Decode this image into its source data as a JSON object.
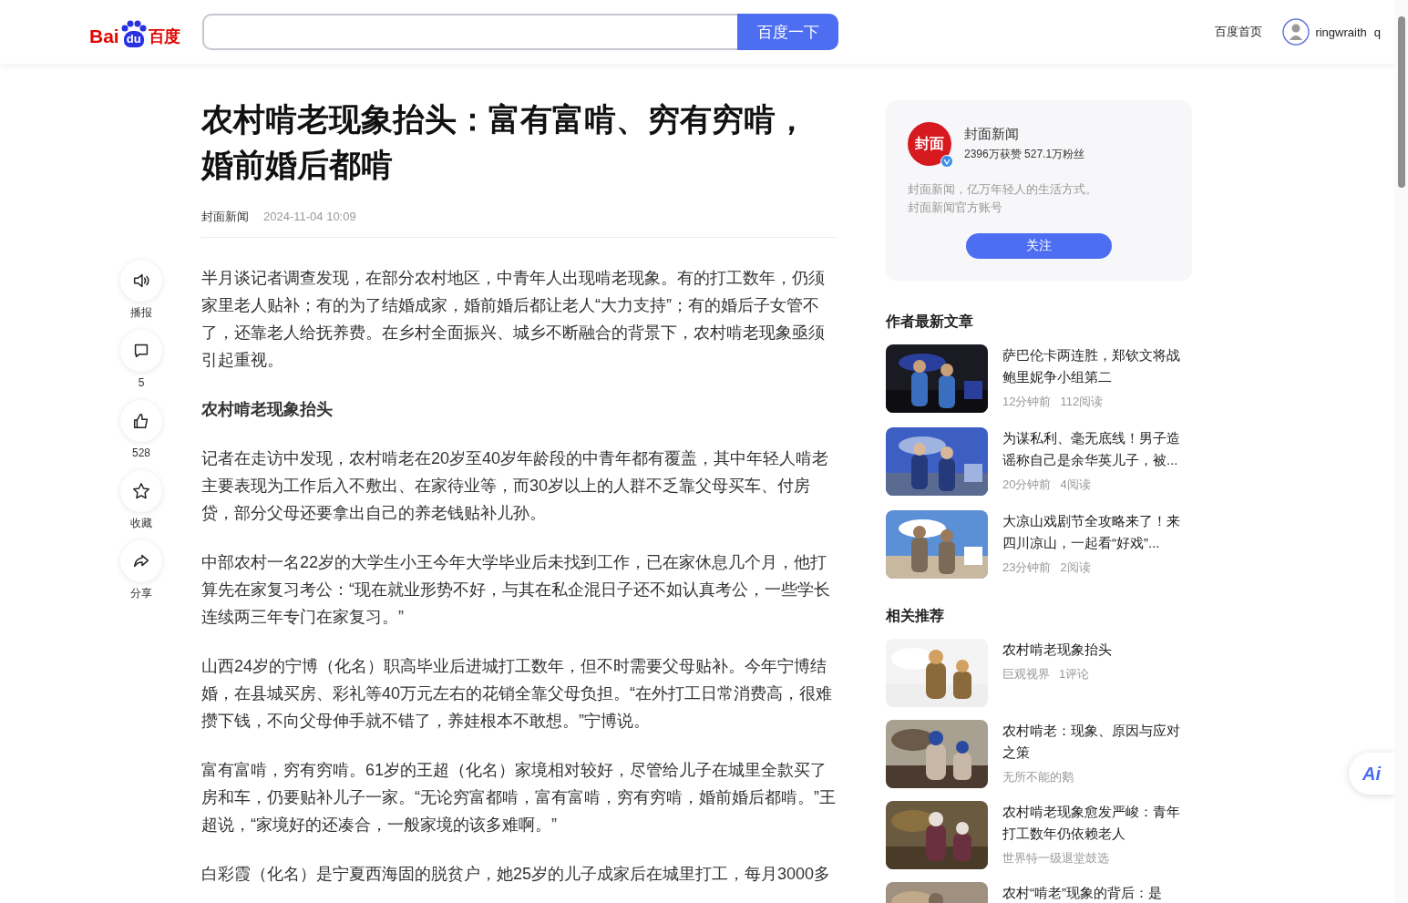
{
  "header": {
    "logo": {
      "left": "Bai",
      "paw": "du",
      "right": "百度"
    },
    "search": {
      "button": "百度一下"
    },
    "nav": {
      "home": "百度首页",
      "user": "ringwraith",
      "user_extra": "q"
    }
  },
  "actions": [
    {
      "kind": "speaker",
      "label": "播报"
    },
    {
      "kind": "comment",
      "label": "5"
    },
    {
      "kind": "like",
      "label": "528"
    },
    {
      "kind": "star",
      "label": "收藏"
    },
    {
      "kind": "share",
      "label": "分享"
    }
  ],
  "article": {
    "title": "农村啃老现象抬头：富有富啃、穷有穷啃，婚前婚后都啃",
    "source": "封面新闻",
    "date": "2024-11-04 10:09",
    "paragraphs": [
      {
        "kind": "text",
        "text": "半月谈记者调查发现，在部分农村地区，中青年人出现啃老现象。有的打工数年，仍须家里老人贴补；有的为了结婚成家，婚前婚后都让老人“大力支持”；有的婚后子女管不了，还靠老人给抚养费。在乡村全面振兴、城乡不断融合的背景下，农村啃老现象亟须引起重视。"
      },
      {
        "kind": "heading",
        "text": "农村啃老现象抬头"
      },
      {
        "kind": "text",
        "text": "记者在走访中发现，农村啃老在20岁至40岁年龄段的中青年都有覆盖，其中年轻人啃老主要表现为工作后入不敷出、在家待业等，而30岁以上的人群不乏靠父母买车、付房贷，部分父母还要拿出自己的养老钱贴补儿孙。"
      },
      {
        "kind": "text",
        "text": "中部农村一名22岁的大学生小王今年大学毕业后未找到工作，已在家休息几个月，他打算先在家复习考公：“现在就业形势不好，与其在私企混日子还不如认真考公，一些学长连续两三年专门在家复习。”"
      },
      {
        "kind": "text",
        "text": "山西24岁的宁博（化名）职高毕业后进城打工数年，但不时需要父母贴补。今年宁博结婚，在县城买房、彩礼等40万元左右的花销全靠父母负担。“在外打工日常消费高，很难攒下钱，不向父母伸手就不错了，养娃根本不敢想。”宁博说。"
      },
      {
        "kind": "text",
        "text": "富有富啃，穷有穷啃。61岁的王超（化名）家境相对较好，尽管给儿子在城里全款买了房和车，仍要贴补儿子一家。“无论穷富都啃，富有富啃，穷有穷啃，婚前婚后都啃。”王超说，“家境好的还凑合，一般家境的该多难啊。”"
      },
      {
        "kind": "text",
        "text": "白彩霞（化名）是宁夏西海固的脱贫户，她25岁的儿子成家后在城里打工，每月3000多"
      }
    ]
  },
  "author": {
    "avatar_text": "封面",
    "verified": true,
    "name": "封面新闻",
    "stats": "2396万获赞 527.1万粉丝",
    "bio": [
      "封面新闻，亿万年轻人的生活方式。",
      "封面新闻官方账号"
    ],
    "follow": "关注"
  },
  "latest": {
    "title": "作者最新文章",
    "items": [
      {
        "title": "萨巴伦卡两连胜，郑钦文将战鲍里妮争小组第二",
        "meta": [
          "12分钟前",
          "112阅读"
        ]
      },
      {
        "title": "为谋私利、毫无底线！男子造谣称自己是余华英儿子，被...",
        "meta": [
          "20分钟前",
          "4阅读"
        ]
      },
      {
        "title": "大凉山戏剧节全攻略来了！来四川凉山，一起看“好戏”...",
        "meta": [
          "23分钟前",
          "2阅读"
        ]
      }
    ]
  },
  "related": {
    "title": "相关推荐",
    "items": [
      {
        "title": "农村啃老现象抬头",
        "meta": [
          "巨观视界",
          "1评论"
        ]
      },
      {
        "title": "农村啃老：现象、原因与应对之策",
        "meta": [
          "无所不能的鹅"
        ]
      },
      {
        "title": "农村啃老现象愈发严峻：青年打工数年仍依赖老人",
        "meta": [
          "世界特一级退堂鼓选"
        ]
      },
      {
        "title": "农村“啃老”现象的背后：是"
      }
    ]
  },
  "assistant": {
    "label": "Ai"
  }
}
